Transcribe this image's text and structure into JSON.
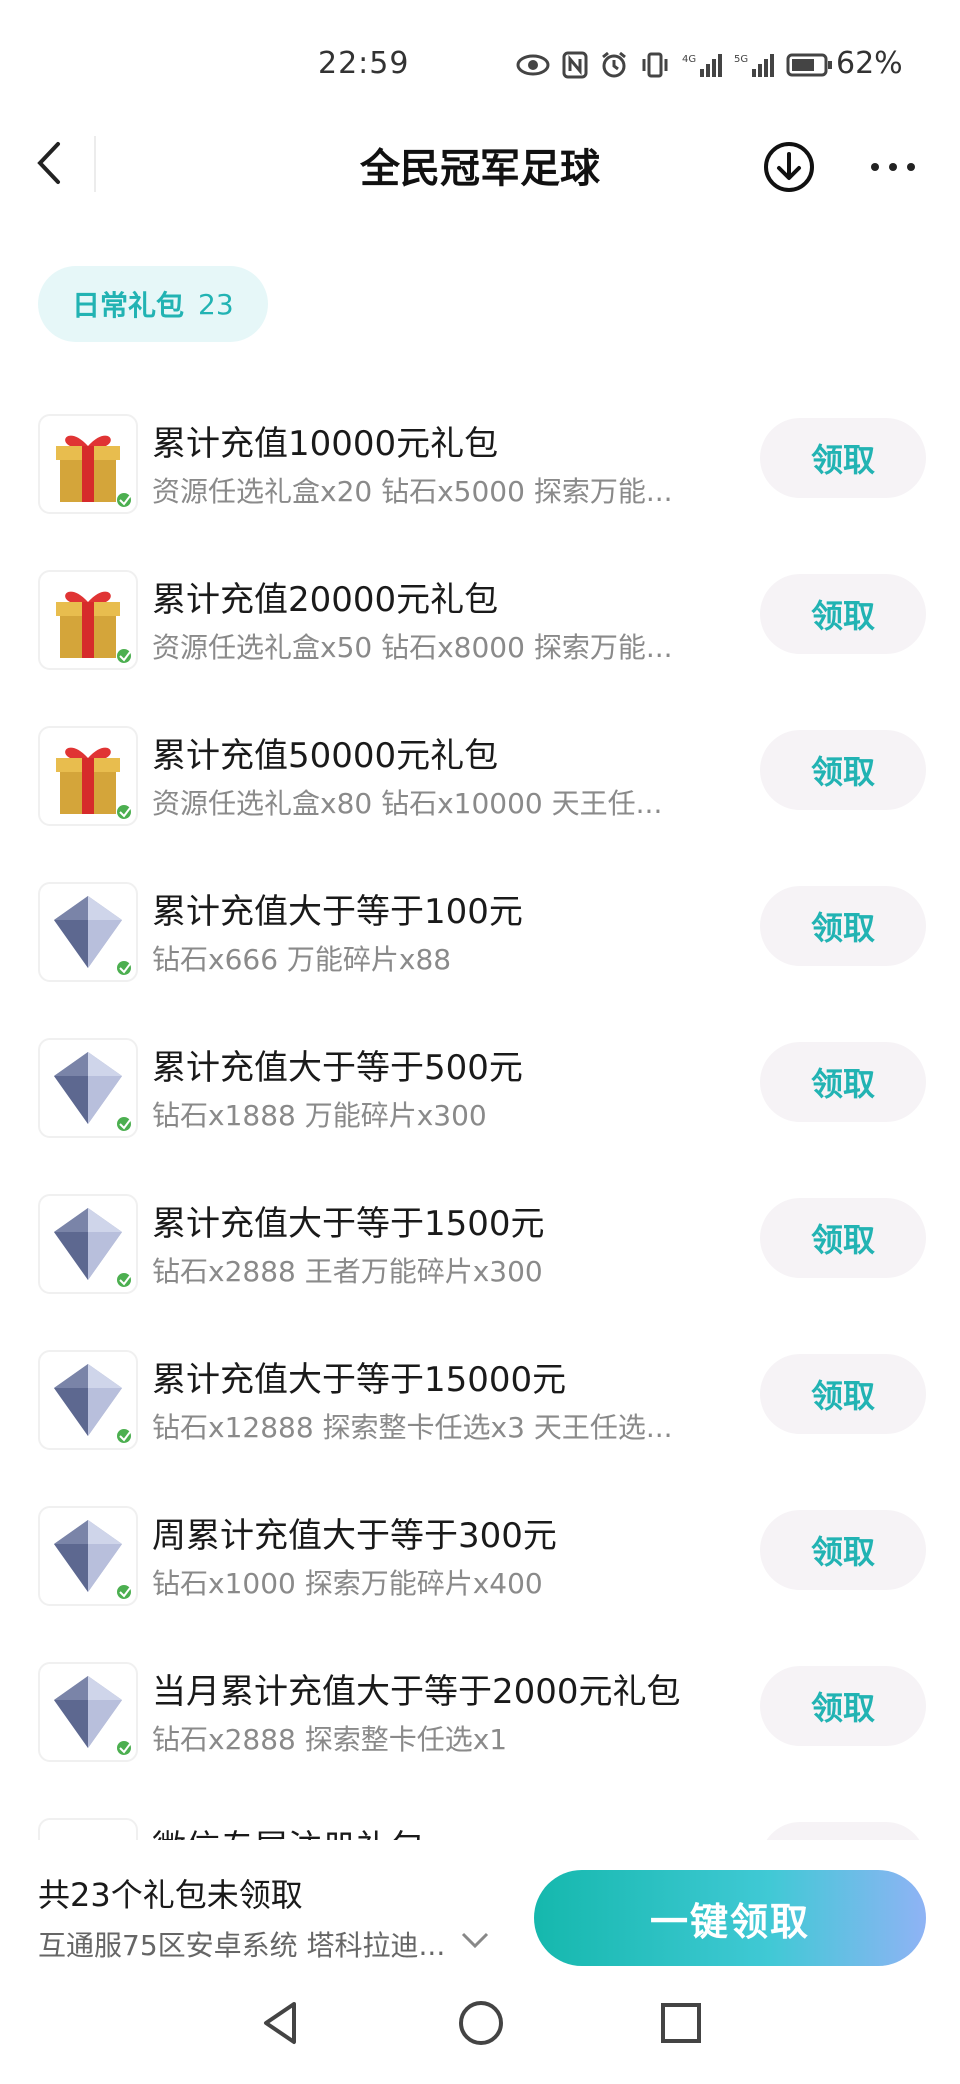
{
  "status_bar": {
    "time": "22:59",
    "battery_pct": "62%"
  },
  "header": {
    "title": "全民冠军足球"
  },
  "tag": {
    "label": "日常礼包",
    "count": "23"
  },
  "gifts": [
    {
      "name": "累计充值10000元礼包",
      "desc": "资源任选礼盒x20 钻石x5000 探索万能...",
      "icon": "gift-box-icon",
      "button": "领取"
    },
    {
      "name": "累计充值20000元礼包",
      "desc": "资源任选礼盒x50 钻石x8000 探索万能...",
      "icon": "gift-box-icon",
      "button": "领取"
    },
    {
      "name": "累计充值50000元礼包",
      "desc": "资源任选礼盒x80 钻石x10000 天王任...",
      "icon": "gift-box-icon",
      "button": "领取"
    },
    {
      "name": "累计充值大于等于100元",
      "desc": "钻石x666 万能碎片x88",
      "icon": "diamond-icon",
      "button": "领取"
    },
    {
      "name": "累计充值大于等于500元",
      "desc": "钻石x1888 万能碎片x300",
      "icon": "diamond-icon",
      "button": "领取"
    },
    {
      "name": "累计充值大于等于1500元",
      "desc": "钻石x2888 王者万能碎片x300",
      "icon": "diamond-icon",
      "button": "领取"
    },
    {
      "name": "累计充值大于等于15000元",
      "desc": "钻石x12888 探索整卡任选x3 天王任选...",
      "icon": "diamond-icon",
      "button": "领取"
    },
    {
      "name": "周累计充值大于等于300元",
      "desc": "钻石x1000 探索万能碎片x400",
      "icon": "diamond-icon",
      "button": "领取"
    },
    {
      "name": "当月累计充值大于等于2000元礼包",
      "desc": "钻石x2888 探索整卡任选x1",
      "icon": "diamond-icon",
      "button": "领取"
    },
    {
      "name": "微信专属注册礼包",
      "desc": "",
      "icon": "whistle-icon",
      "button": "领取"
    }
  ],
  "footer": {
    "unclaimed": "共23个礼包未领取",
    "server": "互通服75区安卓系统 塔科拉迪...",
    "claim_all": "一键领取"
  },
  "colors": {
    "accent": "#22b3b3",
    "button_bg": "#f6f3f6",
    "tag_bg": "#e6f7f8"
  }
}
